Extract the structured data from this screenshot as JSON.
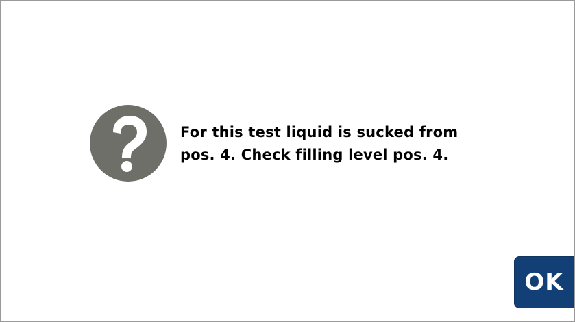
{
  "dialog": {
    "message": "For this test liquid is sucked from\npos. 4. Check filling level pos. 4.",
    "icon": "question-icon",
    "ok_label": "OK"
  },
  "colors": {
    "icon_background": "#6f6f69",
    "button_background": "#123f75",
    "button_text": "#ffffff"
  }
}
